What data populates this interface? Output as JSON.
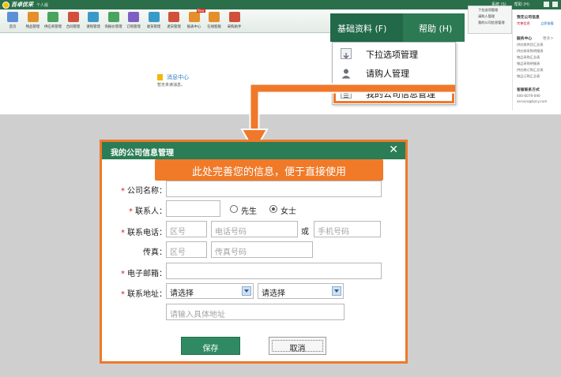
{
  "app": {
    "brand": "百卓优采",
    "edition": "个人版",
    "title_links": [
      "系统 (S)",
      "帮助 (H)"
    ]
  },
  "toolbar": {
    "items": [
      {
        "label": "首页",
        "color": "#5b8fd6"
      },
      {
        "label": "物品管理",
        "color": "#e38f2c"
      },
      {
        "label": "供应商管理",
        "color": "#4aa35f"
      },
      {
        "label": "合同管理",
        "color": "#d0503c"
      },
      {
        "label": "请购管理",
        "color": "#3a9ac7"
      },
      {
        "label": "询报价管理",
        "color": "#4aa35f"
      },
      {
        "label": "订购管理",
        "color": "#7d5fc2"
      },
      {
        "label": "收货管理",
        "color": "#3a9ac7"
      },
      {
        "label": "退货管理",
        "color": "#d0503c"
      },
      {
        "label": "报表中心",
        "color": "#e38f2c",
        "badge": "New"
      },
      {
        "label": "在线客服",
        "color": "#e38f2c"
      },
      {
        "label": "采购助手",
        "color": "#d0503c"
      }
    ]
  },
  "message": {
    "title": "消息中心",
    "subtitle": "暂无未读消息。"
  },
  "menubar": {
    "main": "基础资料 (F)",
    "help": "帮助 (H)"
  },
  "dropdown": {
    "items": [
      {
        "label": "下拉选项管理",
        "icon": "download-icon"
      },
      {
        "label": "请购人管理",
        "icon": "person-icon"
      },
      {
        "label": "我的公司信息管理",
        "icon": "document-icon"
      }
    ]
  },
  "mini_menu": {
    "items": [
      "下拉选项管理",
      "请购人管理",
      "我的公司信息管理"
    ]
  },
  "side": {
    "title": "我无公司信息",
    "link1": "完善信息",
    "link2": "立即查看",
    "section": "服务中心",
    "more": "更多>",
    "lines": [
      "供应商供货汇总表",
      "供应商采购明细表",
      "物品采购汇总表",
      "物品采购明细表",
      "供应商订购汇总表",
      "物品订购汇总表"
    ],
    "contact_title": "客服联系方式",
    "phone": "400-6079-090",
    "email": "service@bzcy.com"
  },
  "dialog": {
    "title": "我的公司信息管理",
    "close": "✕",
    "callout": "此处完善您的信息，便于直接使用",
    "required_mark": "*",
    "company_label": "公司名称：",
    "contact_label": "联系人：",
    "gender": {
      "male": "先生",
      "female": "女士",
      "selected": "female"
    },
    "phone_label": "联系电话：",
    "area_code_placeholder": "区号",
    "phone_placeholder": "电话号码",
    "or": "或",
    "mobile_placeholder": "手机号码",
    "fax_label": "传真：",
    "fax_area_placeholder": "区号",
    "fax_placeholder": "传真号码",
    "email_label": "电子邮箱：",
    "address_label": "联系地址：",
    "province_value": "请选择",
    "city_value": "请选择",
    "address_placeholder": "请输入具体地址",
    "save": "保存",
    "cancel": "取消"
  },
  "colors": {
    "brand_green": "#2a7d55",
    "highlight_orange": "#f0782a",
    "required_red": "#d0202a"
  }
}
